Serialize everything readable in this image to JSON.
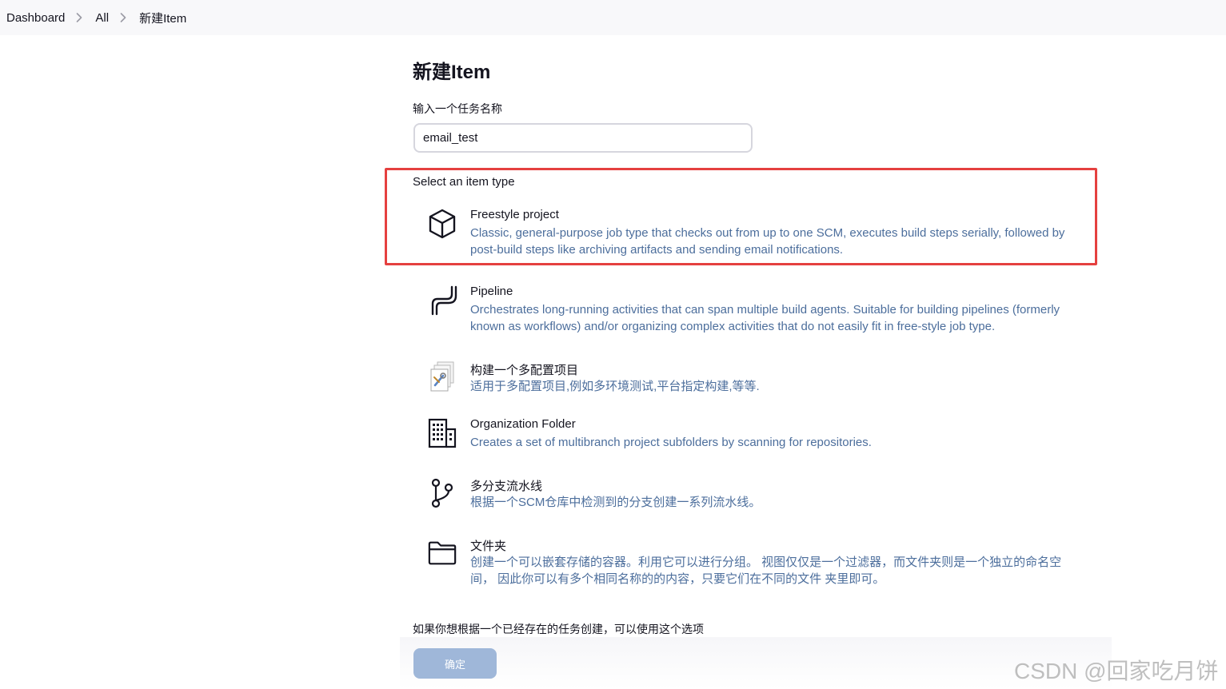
{
  "breadcrumb": {
    "items": [
      "Dashboard",
      "All",
      "新建Item"
    ]
  },
  "page": {
    "title": "新建Item",
    "name_label": "输入一个任务名称",
    "name_value": "email_test",
    "type_label": "Select an item type"
  },
  "item_types": [
    {
      "icon": "cube-icon",
      "title": "Freestyle project",
      "description": "Classic, general-purpose job type that checks out from up to one SCM, executes build steps serially, followed by post-build steps like archiving artifacts and sending email notifications."
    },
    {
      "icon": "pipeline-icon",
      "title": "Pipeline",
      "description": "Orchestrates long-running activities that can span multiple build agents. Suitable for building pipelines (formerly known as workflows) and/or organizing complex activities that do not easily fit in free-style job type."
    },
    {
      "icon": "multi-config-icon",
      "title": "构建一个多配置项目",
      "description": "适用于多配置项目,例如多环境测试,平台指定构建,等等."
    },
    {
      "icon": "building-icon",
      "title": "Organization Folder",
      "description": "Creates a set of multibranch project subfolders by scanning for repositories."
    },
    {
      "icon": "branch-icon",
      "title": "多分支流水线",
      "description": "根据一个SCM仓库中检测到的分支创建一系列流水线。"
    },
    {
      "icon": "folder-icon",
      "title": "文件夹",
      "description": "创建一个可以嵌套存储的容器。利用它可以进行分组。 视图仅仅是一个过滤器，而文件夹则是一个独立的命名空间， 因此你可以有多个相同名称的的内容，只要它们在不同的文件 夹里即可。"
    }
  ],
  "copy": {
    "label": "如果你想根据一个已经存在的任务创建，可以使用这个选项"
  },
  "actions": {
    "ok_label": "确定"
  },
  "watermark": "CSDN @回家吃月饼",
  "colors": {
    "highlight": "#e5403f",
    "description": "#4c6e9c",
    "button": "#9fb7d9"
  }
}
